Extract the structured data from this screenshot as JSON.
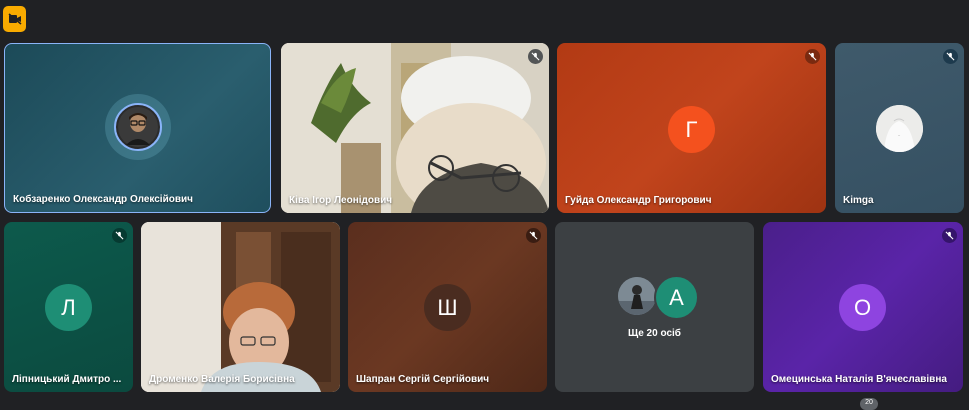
{
  "participants": [
    {
      "name": "Кобзаренко Олександр Олексійович"
    },
    {
      "name": "Ківа Ігор Леонідович"
    },
    {
      "name": "Гуйда Олександр Григорович",
      "initial": "Г"
    },
    {
      "name": "Kimga"
    },
    {
      "name": "Ліпницький Дмитро ...",
      "initial": "Л"
    },
    {
      "name": "Дроменко Валерія Борисівна"
    },
    {
      "name": "Шапран Сергій Сергійович",
      "initial": "Ш"
    },
    {
      "name": "Омецинська Наталія В'ячеславівна",
      "initial": "О"
    }
  ],
  "more_tile": {
    "initial": "А",
    "label": "Ще 20 осіб"
  },
  "bottom_badge": "20",
  "colors": {
    "accent_yellow": "#f9ab00",
    "active_border": "#8ab4f8",
    "orange_avatar": "#f4511e",
    "teal_avatar": "#1e8e75",
    "purple_avatar": "#8e44e0"
  },
  "icons": [
    "camera-off-icon",
    "mic-off-icon"
  ]
}
